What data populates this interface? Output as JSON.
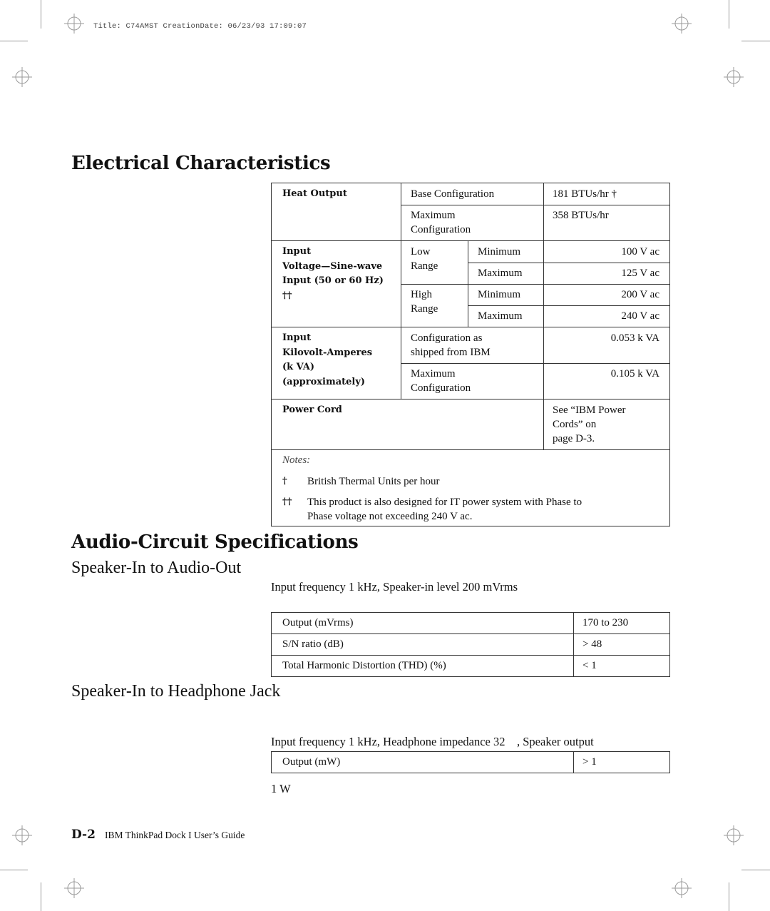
{
  "header": {
    "title_line": "Title: C74AMST CreationDate: 06/23/93 17:09:07"
  },
  "electrical": {
    "heading": "Electrical Characteristics",
    "heat_output": {
      "label": "Heat Output",
      "rows": [
        {
          "config": "Base Configuration",
          "value": "181 BTUs/hr †"
        },
        {
          "config_line1": "Maximum",
          "config_line2": "Configuration",
          "value": "358 BTUs/hr"
        }
      ]
    },
    "input_voltage": {
      "label_lines": [
        "Input",
        "Voltage—Sine-wave",
        "Input (50 or 60 Hz)",
        "††"
      ],
      "ranges": [
        {
          "name_lines": [
            "Low",
            "Range"
          ],
          "rows": [
            {
              "bound": "Minimum",
              "value": "100 V ac"
            },
            {
              "bound": "Maximum",
              "value": "125 V ac"
            }
          ]
        },
        {
          "name_lines": [
            "High",
            "Range"
          ],
          "rows": [
            {
              "bound": "Minimum",
              "value": "200 V ac"
            },
            {
              "bound": "Maximum",
              "value": "240 V ac"
            }
          ]
        }
      ]
    },
    "input_kva": {
      "label_lines": [
        "Input",
        "Kilovolt-Amperes",
        "(k  VA)",
        "(approximately)"
      ],
      "rows": [
        {
          "config_lines": [
            "Configuration as",
            "shipped from IBM"
          ],
          "value": "0.053 k  VA"
        },
        {
          "config_lines": [
            "Maximum",
            "Configuration"
          ],
          "value": "0.105 k  VA"
        }
      ]
    },
    "power_cord": {
      "label": "Power Cord",
      "value_lines": [
        "See “IBM Power",
        "Cords” on",
        "page  D-3."
      ]
    },
    "notes": {
      "label": "Notes:",
      "items": [
        {
          "mark": "†",
          "lines": [
            "British Thermal Units per hour"
          ]
        },
        {
          "mark": "††",
          "lines": [
            "This product is also designed for IT power system with Phase to",
            "Phase voltage not exceeding 240 V ac."
          ]
        }
      ]
    }
  },
  "audio": {
    "heading": "Audio-Circuit Specifications",
    "speaker_audio_out": {
      "subheading": "Speaker-In to Audio-Out",
      "description": "Input frequency 1 kHz, Speaker-in level 200 mVrms",
      "rows": [
        {
          "param": "Output (mVrms)",
          "value": "170 to 230"
        },
        {
          "param": "S/N ratio (dB)",
          "value": "> 48"
        },
        {
          "param": "Total Harmonic Distortion (THD) (%)",
          "value": "< 1"
        }
      ]
    },
    "speaker_headphone": {
      "subheading": "Speaker-In to Headphone Jack",
      "description_line1": "Input frequency 1 kHz, Headphone impedance 32    , Speaker output",
      "description_line2": "1 W",
      "rows": [
        {
          "param": "Output (mW)",
          "value": "> 1"
        }
      ]
    }
  },
  "footer": {
    "page_number": "D-2",
    "book_title": "IBM ThinkPad Dock I User’s Guide"
  }
}
